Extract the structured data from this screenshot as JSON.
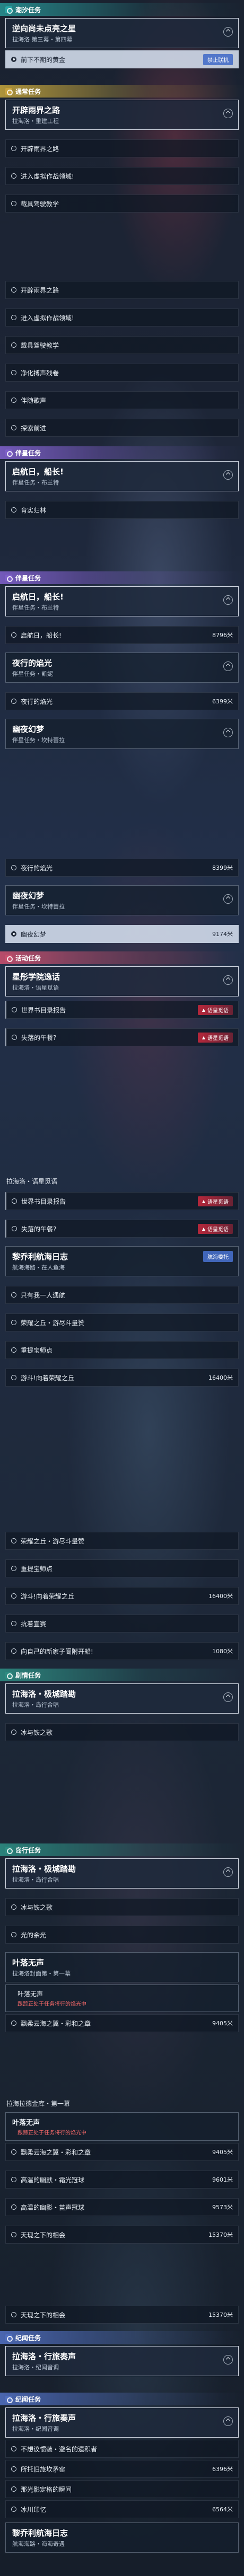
{
  "shot1": {
    "header": "潮汐任务",
    "card_title": "逆向尚未点亮之星",
    "card_sub": "拉海洛 第三幕・第四幕",
    "row_label": "前下不期的黄金",
    "badge": "禁止联机"
  },
  "shot2": {
    "header": "通常任务",
    "card_title": "开辟雨界之路",
    "card_sub": "拉海洛・重建工程",
    "rows": [
      "开辟雨界之路",
      "进入虚拟作战领域!",
      "载具驾驶教学"
    ]
  },
  "shot3": {
    "rows": [
      "开辟雨界之路",
      "进入虚拟作战领域!",
      "载具驾驶教学",
      "净化搏声残卷",
      "伴随歌声",
      "探索前进"
    ],
    "header": "伴星任务",
    "card_title": "启航日，船长!",
    "card_sub": "伴星任务・布兰特",
    "row_after": "育实归林"
  },
  "shot4": {
    "header": "伴星任务",
    "card1_title": "启航日，船长!",
    "card1_sub": "伴星任务・布兰特",
    "card1_row": "启航日，船长!",
    "card1_dist": "8796米",
    "card2_title": "夜行的焰光",
    "card2_sub": "伴星任务・凯妮",
    "card2_row": "夜行的焰光",
    "card2_dist": "6399米",
    "card3_title": "幽夜幻梦",
    "card3_sub": "伴星任务・坎特蕾拉"
  },
  "shot5": {
    "row1": "夜行的焰光",
    "row1_dist": "8399米",
    "card_title": "幽夜幻梦",
    "card_sub": "伴星任务・坎特蕾拉",
    "row2": "幽夜幻梦",
    "row2_dist": "9174米",
    "header": "活动任务",
    "card2_title": "星彤学院逸话",
    "card2_sub": "拉海洛・语星觅语",
    "badge": "语星觅语",
    "row3": "世界书目录报告",
    "row4": "失落的午餐?"
  },
  "shot6": {
    "card_sub": "拉海洛・语星觅语",
    "badge": "语星觅语",
    "row1": "世界书目录报告",
    "row2": "失落的午餐?",
    "card_title": "黎乔利航海日志",
    "card_sub2": "航海海路・在人鱼海",
    "badge2": "航海委托",
    "rows": [
      "只有我一人遇航",
      "荣耀之丘・游尽斗量赞",
      "重提宝师点",
      "游斗!向着荣耀之丘"
    ],
    "dist": "16400米"
  },
  "shot7": {
    "rows": [
      "荣耀之丘・游尽斗量赞",
      "重提宝师点",
      "游斗!向着荣耀之丘",
      "抗着宣赛",
      "向自己的新家子阁附开船!"
    ],
    "dist1": "16400米",
    "dist2": "1080米",
    "header": "剧情任务",
    "card_title": "拉海洛・极城踏勘",
    "card_sub": "拉海洛・岛行合唱",
    "row_last": "冰与铁之歌"
  },
  "shot8": {
    "header": "岛行任务",
    "card_title": "拉海洛・极城踏勘",
    "card_sub": "拉海洛・岛行合唱",
    "rows": [
      "冰与铁之歌",
      "光的余光"
    ],
    "card2_title": "叶落无声",
    "card2_sub": "拉海洛封面第・第一幕",
    "row_quest": "叶落无声",
    "warn": "跟踪正处于任务将行的焰光中",
    "row_dist_label": "飘柔云海之翼・彩和之章",
    "row_dist": "9405米"
  },
  "shot9": {
    "small": "拉海拉德金库・第一幕",
    "card_title": "叶落无声",
    "warn": "跟踪正处于任务将行的焰光中",
    "rows": [
      "飘柔云海之翼・彩和之章",
      "高温的幽默・霜光冠球",
      "高温的幽影・苗声冠球",
      "天现之下的相会"
    ],
    "dists": [
      "9405米",
      "9601米",
      "9573米",
      "15370米"
    ]
  },
  "shot10": {
    "row1": "天现之下的相会",
    "row1_dist": "15370米",
    "header": "纪闻任务",
    "card_title": "拉海洛・行旅奏声",
    "card_sub": "拉海洛・纪闻音调"
  },
  "shot11": {
    "header": "纪闻任务",
    "card_title": "拉海洛・行旅奏声",
    "card_sub": "拉海洛・纪闻音调",
    "rows": [
      "不想议惯装・避名的遗积者",
      "所托旧旅坎矛窑",
      "那光影定格的瞬间",
      "冰川印忆"
    ],
    "dists": [
      "",
      "6396米",
      "",
      "6564米"
    ],
    "card2_title": "黎乔利航海日志",
    "card2_sub": "航海海路・海海奇遇"
  }
}
